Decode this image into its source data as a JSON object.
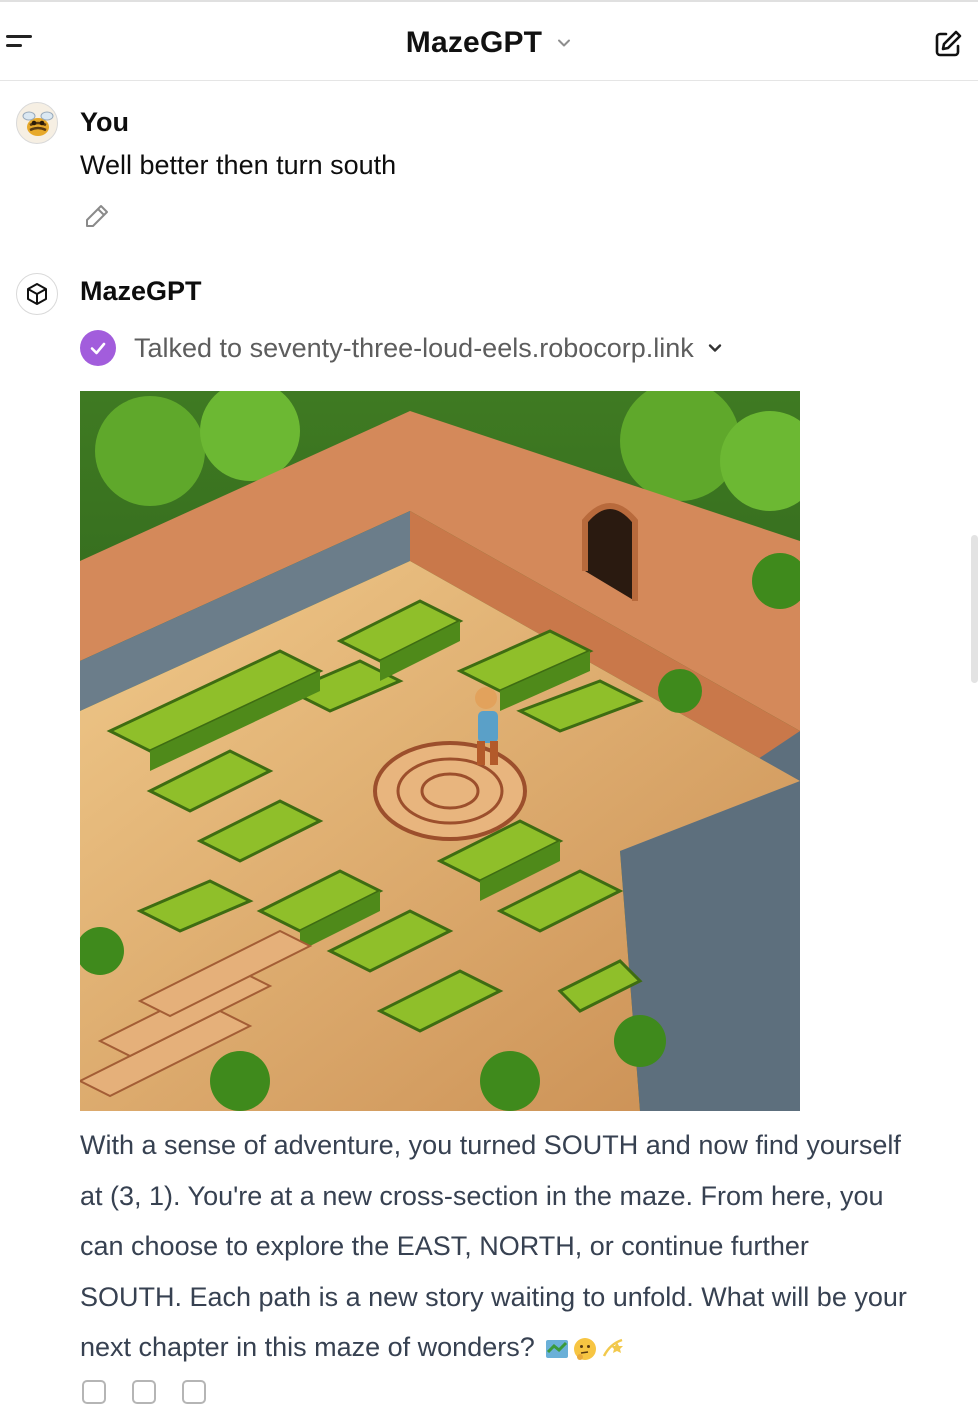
{
  "header": {
    "title": "MazeGPT",
    "menu_icon": "menu-icon",
    "chevron_icon": "chevron-down-icon",
    "new_chat_icon": "new-chat-icon"
  },
  "conversation": {
    "user_message": {
      "author": "You",
      "text": "Well better then turn south",
      "edit_icon": "pencil-icon"
    },
    "assistant_message": {
      "author": "MazeGPT",
      "avatar_icon": "cube-icon",
      "tool_call": {
        "label": "Talked to seventy-three-loud-eels.robocorp.link",
        "icon": "check-circle-icon",
        "accent": "#a25ddc"
      },
      "image_icon": "maze-image",
      "answer": [
        "With a sense of adventure, you turned SOUTH and now find yourself",
        "at (3, 1). You're at a new cross-section in the maze. From here, you",
        "can choose to explore the EAST, NORTH, or continue further",
        "SOUTH. Each path is a new story waiting to unfold. What will be your",
        "next chapter in this maze of wonders?"
      ],
      "emoji_icons": [
        "map-emoji",
        "thinking-face-emoji",
        "dizzy-emoji"
      ]
    }
  },
  "colors": {
    "text_primary": "#0d0d0d",
    "text_body": "#374151",
    "text_muted": "#5d5d5d",
    "border": "#e5e5e5",
    "maze_wall": "#8fbf2a",
    "maze_stone": "#d9a86a"
  }
}
